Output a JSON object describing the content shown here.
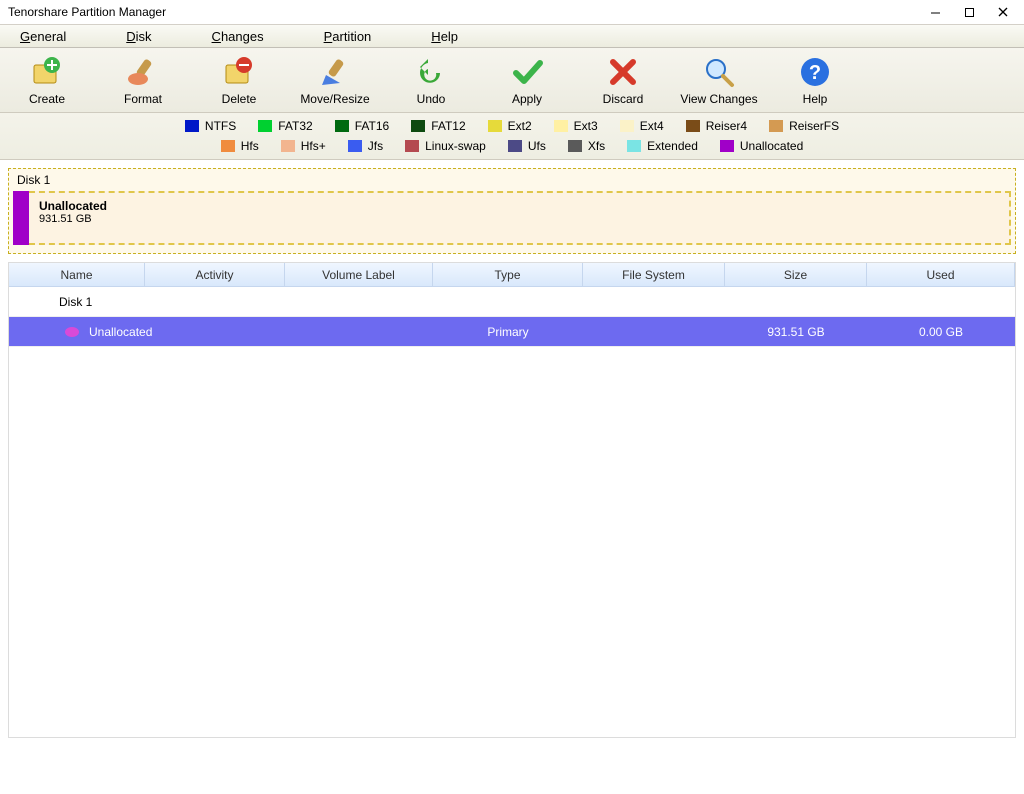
{
  "window": {
    "title": "Tenorshare Partition Manager"
  },
  "menu": {
    "general": "General",
    "disk": "Disk",
    "changes": "Changes",
    "partition": "Partition",
    "help": "Help"
  },
  "toolbar": {
    "create": "Create",
    "format": "Format",
    "delete": "Delete",
    "move_resize": "Move/Resize",
    "undo": "Undo",
    "apply": "Apply",
    "discard": "Discard",
    "view_changes": "View Changes",
    "help": "Help"
  },
  "legend": {
    "ntfs": {
      "label": "NTFS",
      "color": "#0018c8"
    },
    "fat32": {
      "label": "FAT32",
      "color": "#00d030"
    },
    "fat16": {
      "label": "FAT16",
      "color": "#006a10"
    },
    "fat12": {
      "label": "FAT12",
      "color": "#0e4a10"
    },
    "ext2": {
      "label": "Ext2",
      "color": "#e6da3a"
    },
    "ext3": {
      "label": "Ext3",
      "color": "#fff0a3"
    },
    "ext4": {
      "label": "Ext4",
      "color": "#fbf2c8"
    },
    "reiser4": {
      "label": "Reiser4",
      "color": "#7a4c18"
    },
    "reiserfs": {
      "label": "ReiserFS",
      "color": "#d49a52"
    },
    "hfs": {
      "label": "Hfs",
      "color": "#f08c3e"
    },
    "hfsplus": {
      "label": "Hfs+",
      "color": "#f2b58f"
    },
    "jfs": {
      "label": "Jfs",
      "color": "#3a5cf0"
    },
    "linuxswap": {
      "label": "Linux-swap",
      "color": "#b44a50"
    },
    "ufs": {
      "label": "Ufs",
      "color": "#4c4a86"
    },
    "xfs": {
      "label": "Xfs",
      "color": "#5a5a5a"
    },
    "extended": {
      "label": "Extended",
      "color": "#7ae4e4"
    },
    "unalloc": {
      "label": "Unallocated",
      "color": "#a000c8"
    }
  },
  "diskmap": {
    "label": "Disk 1",
    "name": "Unallocated",
    "size": "931.51 GB"
  },
  "table": {
    "headers": {
      "name": "Name",
      "activity": "Activity",
      "vol_label": "Volume Label",
      "type": "Type",
      "fs": "File System",
      "size": "Size",
      "used": "Used"
    },
    "disk_row": {
      "name": "Disk 1"
    },
    "rows": [
      {
        "name": "Unallocated",
        "activity": "",
        "vol_label": "",
        "type": "Primary",
        "fs": "",
        "size": "931.51 GB",
        "used": "0.00 GB",
        "selected": true
      }
    ]
  }
}
